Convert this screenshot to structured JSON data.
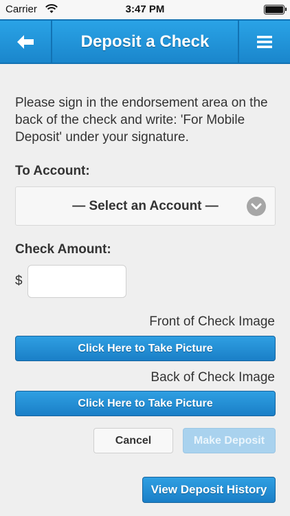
{
  "status_bar": {
    "carrier": "Carrier",
    "time": "3:47 PM",
    "battery_level": 1.0
  },
  "nav": {
    "title": "Deposit a Check",
    "back_icon": "arrow-left-icon",
    "menu_icon": "hamburger-menu-icon"
  },
  "instructions": "Please sign in the endorsement area on the back of the check and write: 'For Mobile Deposit' under your signature.",
  "account": {
    "label": "To Account:",
    "selected": "— Select an Account —",
    "chevron_icon": "chevron-down-icon"
  },
  "amount": {
    "label": "Check Amount:",
    "currency": "$",
    "value": "",
    "placeholder": ""
  },
  "front": {
    "label": "Front of Check Image",
    "button": "Click Here to Take Picture"
  },
  "back": {
    "label": "Back of Check Image",
    "button": "Click Here to Take Picture"
  },
  "actions": {
    "cancel": "Cancel",
    "make_deposit": "Make Deposit",
    "view_history": "View Deposit History"
  },
  "colors": {
    "nav_blue": "#1a86cc",
    "button_blue": "#1a7fc7",
    "disabled_blue": "#a9d2ee",
    "background": "#efefef"
  }
}
